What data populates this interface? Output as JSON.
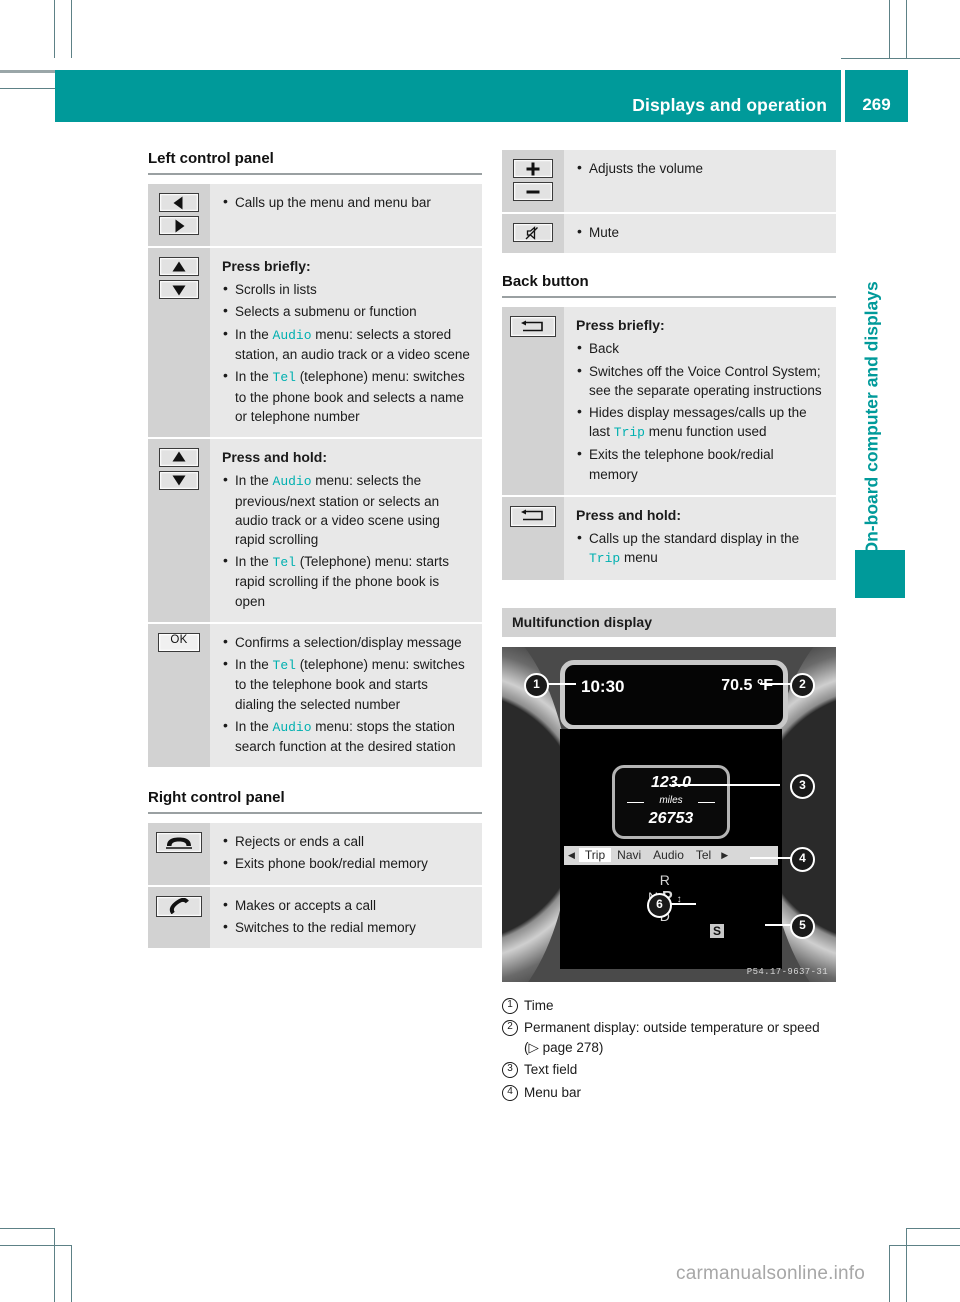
{
  "header": {
    "title": "Displays and operation",
    "page_number": "269",
    "accent_color": "#009a9a"
  },
  "thumb_tab": {
    "label": "On-board computer and displays"
  },
  "watermark": "carmanualsonline.info",
  "left_column": {
    "section1_title": "Left control panel",
    "rows": [
      {
        "icons": [
          "left-arrow-key",
          "right-arrow-key"
        ],
        "heading": "",
        "bullets": [
          [
            {
              "t": "Calls up the menu and menu bar"
            }
          ]
        ]
      },
      {
        "icons": [
          "up-arrow-key",
          "down-arrow-key"
        ],
        "heading": "Press briefly:",
        "bullets": [
          [
            {
              "t": "Scrolls in lists"
            }
          ],
          [
            {
              "t": "Selects a submenu or function"
            }
          ],
          [
            {
              "t": "In the "
            },
            {
              "t": "Audio",
              "m": true
            },
            {
              "t": " menu: selects a stored station, an audio track or a video scene"
            }
          ],
          [
            {
              "t": "In the "
            },
            {
              "t": "Tel",
              "m": true
            },
            {
              "t": " (telephone) menu: switches to the phone book and selects a name or telephone number"
            }
          ]
        ]
      },
      {
        "icons": [
          "up-arrow-key",
          "down-arrow-key"
        ],
        "heading": "Press and hold:",
        "bullets": [
          [
            {
              "t": "In the "
            },
            {
              "t": "Audio",
              "m": true
            },
            {
              "t": " menu: selects the previous/next station or selects an audio track or a video scene using rapid scrolling"
            }
          ],
          [
            {
              "t": "In the "
            },
            {
              "t": "Tel",
              "m": true
            },
            {
              "t": " (Telephone) menu: starts rapid scrolling if the phone book is open"
            }
          ]
        ]
      },
      {
        "icons": [
          "ok-key"
        ],
        "heading": "",
        "bullets": [
          [
            {
              "t": "Confirms a selection/display message"
            }
          ],
          [
            {
              "t": "In the "
            },
            {
              "t": "Tel",
              "m": true
            },
            {
              "t": " (telephone) menu: switches to the telephone book and starts dialing the selected number"
            }
          ],
          [
            {
              "t": "In the "
            },
            {
              "t": "Audio",
              "m": true
            },
            {
              "t": " menu: stops the station search function at the desired station"
            }
          ]
        ]
      }
    ],
    "section2_title": "Right control panel",
    "rows2": [
      {
        "icons": [
          "end-call-key"
        ],
        "heading": "",
        "bullets": [
          [
            {
              "t": "Rejects or ends a call"
            }
          ],
          [
            {
              "t": "Exits phone book/redial memory"
            }
          ]
        ]
      },
      {
        "icons": [
          "accept-call-key"
        ],
        "heading": "",
        "bullets": [
          [
            {
              "t": "Makes or accepts a call"
            }
          ],
          [
            {
              "t": "Switches to the redial memory"
            }
          ]
        ]
      }
    ]
  },
  "right_column": {
    "volume_rows": [
      {
        "icons": [
          "volume-up-key",
          "volume-down-key"
        ],
        "heading": "",
        "bullets": [
          [
            {
              "t": "Adjusts the volume"
            }
          ]
        ]
      },
      {
        "icons": [
          "mute-key"
        ],
        "heading": "",
        "bullets": [
          [
            {
              "t": "Mute"
            }
          ]
        ]
      }
    ],
    "section_title": "Back button",
    "back_rows": [
      {
        "icons": [
          "back-key"
        ],
        "heading": "Press briefly:",
        "bullets": [
          [
            {
              "t": "Back"
            }
          ],
          [
            {
              "t": "Switches off the Voice Control System; see the separate operating instructions"
            }
          ],
          [
            {
              "t": "Hides display messages/calls up the last "
            },
            {
              "t": "Trip",
              "m": true
            },
            {
              "t": " menu function used"
            }
          ],
          [
            {
              "t": "Exits the telephone book/redial memory"
            }
          ]
        ]
      },
      {
        "icons": [
          "back-key"
        ],
        "heading": "Press and hold:",
        "bullets": [
          [
            {
              "t": "Calls up the standard display in the "
            },
            {
              "t": "Trip",
              "m": true
            },
            {
              "t": " menu"
            }
          ]
        ]
      }
    ],
    "mfd_title": "Multifunction display",
    "mfd": {
      "time": "10:30",
      "temperature": "70.5 °F",
      "trip_distance": "123.0",
      "unit": "miles",
      "odometer": "26753",
      "menu_items": [
        "Trip",
        "Navi",
        "Audio",
        "Tel"
      ],
      "menu_selected": "Trip",
      "gear_positions": [
        "R",
        "N",
        "D"
      ],
      "gear_park": "P",
      "gear_mode": "S",
      "image_code": "P54.17-9637-31",
      "callouts": [
        "1",
        "2",
        "3",
        "4",
        "5",
        "6"
      ]
    },
    "legend": [
      {
        "num": "1",
        "text": "Time"
      },
      {
        "num": "2",
        "text": "Permanent display: outside temperature or speed (▷ page 278)"
      },
      {
        "num": "3",
        "text": "Text field"
      },
      {
        "num": "4",
        "text": "Menu bar"
      }
    ]
  }
}
